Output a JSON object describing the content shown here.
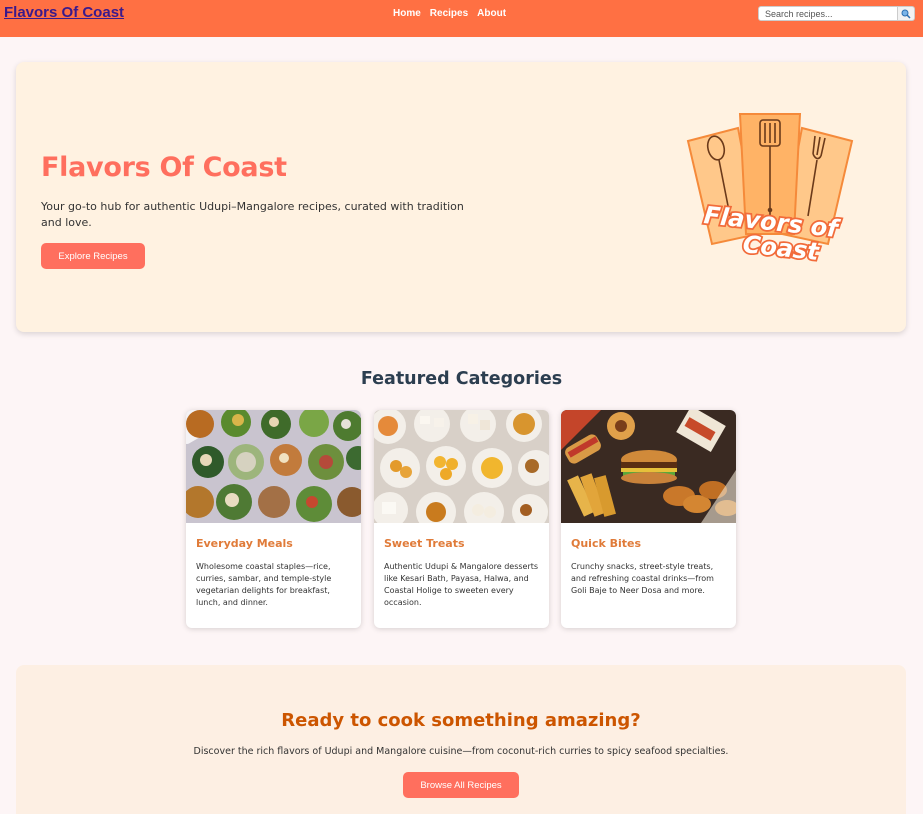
{
  "nav": {
    "brand": "Flavors Of Coast",
    "links": [
      "Home",
      "Recipes",
      "About"
    ],
    "search_placeholder": "Search recipes...",
    "search_icon": "magnifier-icon"
  },
  "hero": {
    "title": "Flavors Of Coast",
    "description": "Your go-to hub for authentic Udupi–Mangalore recipes, curated with tradition and love.",
    "button": "Explore Recipes",
    "logo_text": [
      "Flavors of",
      "Coast"
    ]
  },
  "featured": {
    "title": "Featured Categories",
    "cards": [
      {
        "title": "Everyday Meals",
        "text": "Wholesome coastal staples—rice, curries, sambar, and temple-style vegetarian delights for breakfast, lunch, and dinner."
      },
      {
        "title": "Sweet Treats",
        "text": "Authentic Udupi & Mangalore desserts like Kesari Bath, Payasa, Halwa, and Coastal Holige to sweeten every occasion."
      },
      {
        "title": "Quick Bites",
        "text": "Crunchy snacks, street-style treats, and refreshing coastal drinks—from Goli Baje to Neer Dosa and more."
      }
    ]
  },
  "cta": {
    "title": "Ready to cook something amazing?",
    "description": "Discover the rich flavors of Udupi and Mangalore cuisine—from coconut-rich curries to spicy seafood specialties.",
    "button": "Browse All Recipes"
  },
  "colors": {
    "nav": "#ff7043",
    "accent": "#ff6f5e",
    "hero_bg": "#fff2e1",
    "card_title": "#e07b39",
    "cta_title": "#cc5500"
  }
}
